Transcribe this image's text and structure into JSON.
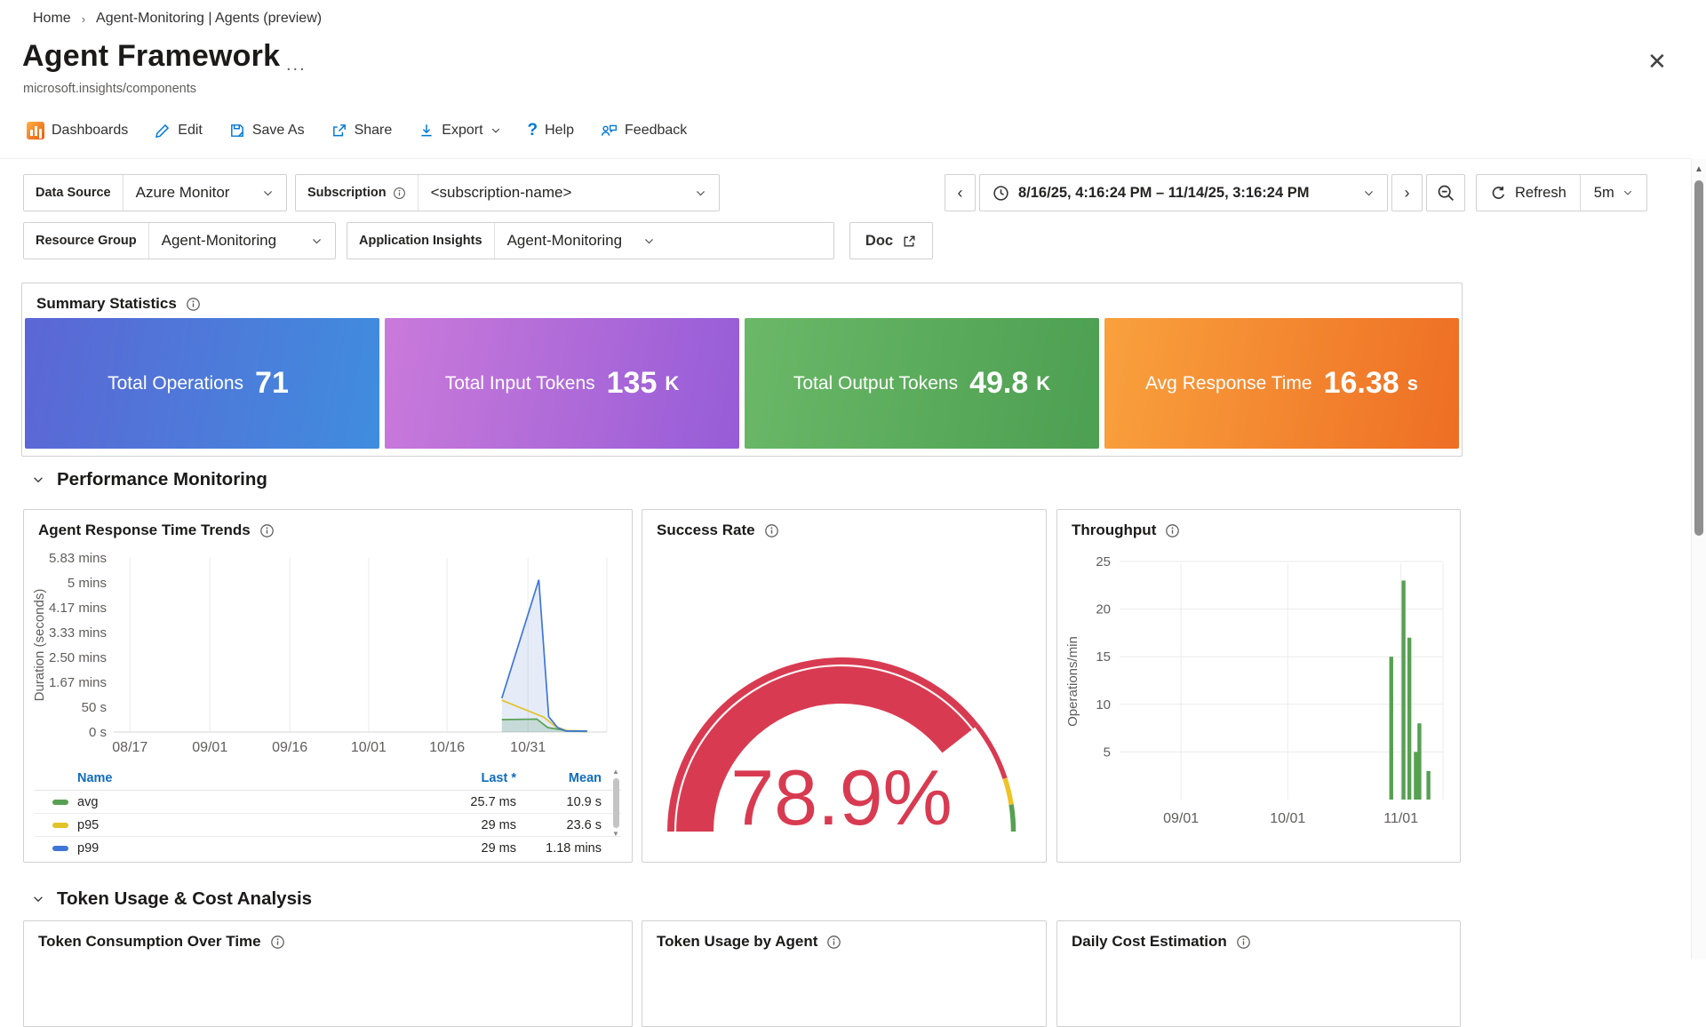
{
  "breadcrumb": {
    "home": "Home",
    "separator": "›",
    "current": "Agent-Monitoring | Agents (preview)"
  },
  "header": {
    "title": "Agent Framework",
    "more": "...",
    "close": "✕",
    "resource_type": "microsoft.insights/components"
  },
  "toolbar": {
    "dashboards": "Dashboards",
    "edit": "Edit",
    "save_as": "Save As",
    "share": "Share",
    "export": "Export",
    "help": "Help",
    "help_glyph": "?",
    "feedback": "Feedback"
  },
  "filters": {
    "data_source": {
      "label": "Data Source",
      "value": "Azure Monitor"
    },
    "subscription": {
      "label": "Subscription",
      "value": "<subscription-name>"
    },
    "resource_group": {
      "label": "Resource Group",
      "value": "Agent-Monitoring"
    },
    "app_insights": {
      "label": "Application Insights",
      "value": "Agent-Monitoring"
    },
    "doc": "Doc",
    "time": {
      "prev": "‹",
      "next": "›",
      "range": "8/16/25, 4:16:24 PM – 11/14/25, 3:16:24 PM",
      "refresh": "Refresh",
      "interval": "5m"
    }
  },
  "summary": {
    "title": "Summary Statistics",
    "tiles": [
      {
        "label": "Total Operations",
        "value": "71",
        "unit": "",
        "gradient": "linear-gradient(100deg,#5c66d5,#3f8dde)"
      },
      {
        "label": "Total Input Tokens",
        "value": "135",
        "unit": "K",
        "gradient": "linear-gradient(100deg,#ca7ada,#965cd7)"
      },
      {
        "label": "Total Output Tokens",
        "value": "49.8",
        "unit": "K",
        "gradient": "linear-gradient(100deg,#6ab868,#4d9f51)"
      },
      {
        "label": "Avg Response Time",
        "value": "16.38",
        "unit": "s",
        "gradient": "linear-gradient(100deg,#f9a13d,#ee6e24)"
      }
    ]
  },
  "sections": {
    "performance": "Performance Monitoring",
    "tokens": "Token Usage & Cost Analysis"
  },
  "panels": {
    "response": {
      "title": "Agent Response Time Trends"
    },
    "success": {
      "title": "Success Rate"
    },
    "throughput": {
      "title": "Throughput"
    },
    "token_time": {
      "title": "Token Consumption Over Time"
    },
    "token_agent": {
      "title": "Token Usage by Agent"
    },
    "daily_cost": {
      "title": "Daily Cost Estimation"
    }
  },
  "chart_data": [
    {
      "type": "area",
      "title": "Agent Response Time Trends",
      "ylabel": "Duration (seconds)",
      "ylim_seconds": [
        0,
        350
      ],
      "yticks": [
        {
          "v": 350,
          "label": "5.83 mins"
        },
        {
          "v": 300,
          "label": "5 mins"
        },
        {
          "v": 250,
          "label": "4.17 mins"
        },
        {
          "v": 200,
          "label": "3.33 mins"
        },
        {
          "v": 150,
          "label": "2.50 mins"
        },
        {
          "v": 100,
          "label": "1.67 mins"
        },
        {
          "v": 50,
          "label": "50 s"
        },
        {
          "v": 0,
          "label": "0 s"
        }
      ],
      "xticks": [
        {
          "f": 0.033,
          "label": "08/17"
        },
        {
          "f": 0.195,
          "label": "09/01"
        },
        {
          "f": 0.357,
          "label": "09/16"
        },
        {
          "f": 0.517,
          "label": "10/01"
        },
        {
          "f": 0.676,
          "label": "10/16"
        },
        {
          "f": 0.84,
          "label": "10/31"
        }
      ],
      "legend": {
        "headers": [
          "Name",
          "Last *",
          "Mean"
        ]
      },
      "series": [
        {
          "name": "avg",
          "color": "#57a052",
          "fill": "rgba(87,160,82,0.22)",
          "last": "25.7 ms",
          "mean": "10.9 s",
          "points": [
            [
              0.787,
              25
            ],
            [
              0.858,
              26
            ],
            [
              0.88,
              9
            ],
            [
              0.905,
              5
            ],
            [
              0.92,
              2
            ],
            [
              0.96,
              1
            ]
          ]
        },
        {
          "name": "p95",
          "color": "#e2c32a",
          "fill": null,
          "last": "29 ms",
          "mean": "23.6 s",
          "points": [
            [
              0.787,
              64
            ],
            [
              0.872,
              30
            ],
            [
              0.897,
              10
            ],
            [
              0.92,
              3
            ],
            [
              0.96,
              2
            ]
          ]
        },
        {
          "name": "p99",
          "color": "#3f76d6",
          "fill": "rgba(91,135,212,0.16)",
          "last": "29 ms",
          "mean": "1.18 mins",
          "points": [
            [
              0.787,
              68
            ],
            [
              0.862,
              306
            ],
            [
              0.882,
              31
            ],
            [
              0.9,
              9
            ],
            [
              0.917,
              2
            ],
            [
              0.96,
              2
            ]
          ]
        }
      ]
    },
    {
      "type": "gauge",
      "title": "Success Rate",
      "value": 78.9,
      "display": "78.9%",
      "min": 0,
      "max": 100,
      "gauge_color": "#d83b51",
      "segments": [
        {
          "from": 78.9,
          "to": 90,
          "color": "#d83b51"
        },
        {
          "from": 90,
          "to": 95,
          "color": "#eec327"
        },
        {
          "from": 95,
          "to": 100,
          "color": "#57a052"
        }
      ]
    },
    {
      "type": "bar",
      "title": "Throughput",
      "ylabel": "Operations/min",
      "ylim": [
        0,
        25
      ],
      "yticks": [
        5,
        10,
        15,
        20,
        25
      ],
      "xticks": [
        {
          "f": 0.19,
          "label": "09/01"
        },
        {
          "f": 0.52,
          "label": "10/01"
        },
        {
          "f": 0.87,
          "label": "11/01"
        }
      ],
      "color": "#57a052",
      "bars": [
        {
          "f": 0.84,
          "v": 15
        },
        {
          "f": 0.878,
          "v": 23
        },
        {
          "f": 0.896,
          "v": 17
        },
        {
          "f": 0.916,
          "v": 5
        },
        {
          "f": 0.927,
          "v": 8
        },
        {
          "f": 0.955,
          "v": 3
        }
      ]
    }
  ]
}
